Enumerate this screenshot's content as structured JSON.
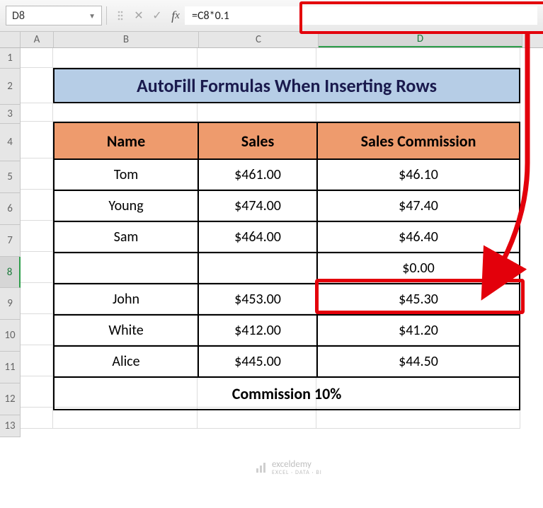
{
  "name_box": "D8",
  "formula": "=C8*0.1",
  "title": "AutoFill Formulas When Inserting Rows",
  "columns": {
    "A": "A",
    "B": "B",
    "C": "C",
    "D": "D"
  },
  "row_numbers": [
    "1",
    "2",
    "3",
    "4",
    "5",
    "6",
    "7",
    "8",
    "9",
    "10",
    "11",
    "12",
    "13"
  ],
  "headers": {
    "name": "Name",
    "sales": "Sales",
    "commission": "Sales Commission"
  },
  "rows": [
    {
      "name": "Tom",
      "sales": "$461.00",
      "commission": "$46.10"
    },
    {
      "name": "Young",
      "sales": "$474.00",
      "commission": "$47.40"
    },
    {
      "name": "Sam",
      "sales": "$464.00",
      "commission": "$46.40"
    },
    {
      "name": "",
      "sales": "",
      "commission": "$0.00"
    },
    {
      "name": "John",
      "sales": "$453.00",
      "commission": "$45.30"
    },
    {
      "name": "White",
      "sales": "$412.00",
      "commission": "$41.20"
    },
    {
      "name": "Alice",
      "sales": "$445.00",
      "commission": "$44.50"
    }
  ],
  "footer": "Commission 10%",
  "watermark": {
    "brand": "exceldemy",
    "sub": "EXCEL · DATA · BI"
  },
  "chart_data": {
    "type": "table",
    "title": "AutoFill Formulas When Inserting Rows",
    "columns": [
      "Name",
      "Sales",
      "Sales Commission"
    ],
    "rows": [
      [
        "Tom",
        461.0,
        46.1
      ],
      [
        "Young",
        474.0,
        47.4
      ],
      [
        "Sam",
        464.0,
        46.4
      ],
      [
        "",
        null,
        0.0
      ],
      [
        "John",
        453.0,
        45.3
      ],
      [
        "White",
        412.0,
        41.2
      ],
      [
        "Alice",
        445.0,
        44.5
      ]
    ],
    "footer": "Commission 10%",
    "active_cell": "D8",
    "active_formula": "=C8*0.1"
  }
}
